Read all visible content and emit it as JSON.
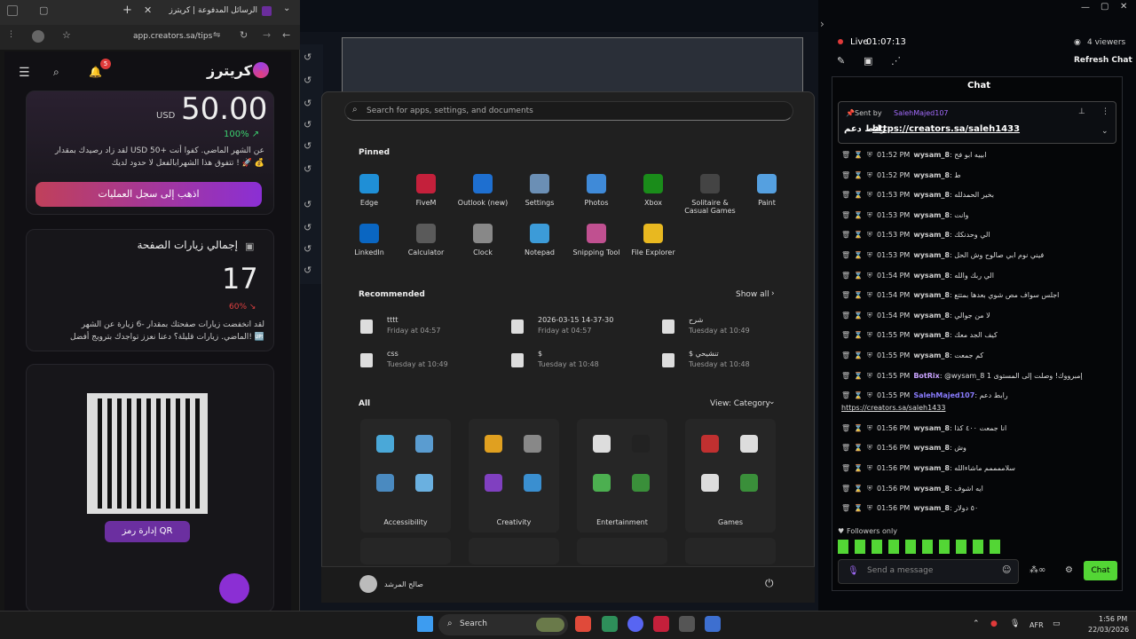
{
  "browser": {
    "tab_title": "الرسائل المدفوعة | كريترز",
    "url": "app.creators.sa/tips",
    "site": {
      "logo": "كريترز",
      "notif_count": "5",
      "amount": "50.00",
      "currency": "USD",
      "change_pct": "100% ↗",
      "balance_text_1": "لقد زاد رصيدك بمقدار USD 50+ عن الشهر الماضي. كفوا أنت",
      "balance_text_2": "تتفوق هذا الشهرابالفعل لا حدود لديك ! 🚀 💰",
      "transactions_button": "اذهب إلى سجل العمليات",
      "visits_title": "إجمالي زيارات الصفحة",
      "visits_value": "17",
      "visits_change": "60% ↘",
      "visits_text_1": "لقد انخفضت زيارات صفحتك بمقدار -6 زيارة عن الشهر",
      "visits_text_2": "الماضي. زيارات قليلة؟ دعنا نعزز تواجدك بترويج أفضل! 🆙",
      "qr_button": "إدارة رمز QR"
    }
  },
  "start_menu": {
    "search_placeholder": "Search for apps, settings, and documents",
    "pinned_title": "Pinned",
    "pinned": [
      {
        "label": "Edge",
        "icon": "edge-icon",
        "color": "#1f8fd6"
      },
      {
        "label": "FiveM",
        "icon": "fivem-icon",
        "color": "#c4203b"
      },
      {
        "label": "Outlook (new)",
        "icon": "outlook-icon",
        "color": "#1e6fd0"
      },
      {
        "label": "Settings",
        "icon": "settings-icon",
        "color": "#6b8fb5"
      },
      {
        "label": "Photos",
        "icon": "photos-icon",
        "color": "#3f8ad8"
      },
      {
        "label": "Xbox",
        "icon": "xbox-icon",
        "color": "#1a8c1a"
      },
      {
        "label": "Solitaire & Casual Games",
        "icon": "solitaire-icon",
        "color": "#444"
      },
      {
        "label": "Paint",
        "icon": "paint-icon",
        "color": "#55a0e0"
      },
      {
        "label": "LinkedIn",
        "icon": "linkedin-icon",
        "color": "#0a66c2"
      },
      {
        "label": "Calculator",
        "icon": "calculator-icon",
        "color": "#5a5a5a"
      },
      {
        "label": "Clock",
        "icon": "clock-icon",
        "color": "#888"
      },
      {
        "label": "Notepad",
        "icon": "notepad-icon",
        "color": "#3c9bd8"
      },
      {
        "label": "Snipping Tool",
        "icon": "snipping-tool-icon",
        "color": "#c05090"
      },
      {
        "label": "File Explorer",
        "icon": "file-explorer-icon",
        "color": "#e8b820"
      }
    ],
    "recommended_title": "Recommended",
    "show_all": "Show all",
    "recommended": [
      {
        "title": "tttt",
        "sub": "Friday at 04:57"
      },
      {
        "title": "2026-03-15 14-37-30",
        "sub": "Friday at 04:57"
      },
      {
        "title": "شرح",
        "sub": "Tuesday at 10:49"
      },
      {
        "title": "css",
        "sub": "Tuesday at 10:49"
      },
      {
        "title": "$",
        "sub": "Tuesday at 10:48"
      },
      {
        "title": "$ تنشيحي",
        "sub": "Tuesday at 10:48"
      }
    ],
    "all_title": "All",
    "view_label": "View: Category",
    "categories": [
      "Accessibility",
      "Creativity",
      "Entertainment",
      "Games"
    ],
    "user_name": "صالح المرشد"
  },
  "chat": {
    "live_label": "Live",
    "live_time": "01:07:13",
    "viewers": "4 viewers",
    "refresh": "Refresh Chat",
    "title": "Chat",
    "pinned_sent_by": "Sent by",
    "pinned_user": "SalehMajed107",
    "pinned_msg": "رابط دعم",
    "pinned_link": "https://creators.sa/saleh1433",
    "messages": [
      {
        "time": "01:52 PM",
        "user": "wysam_8",
        "text": "ابييه ابو فح"
      },
      {
        "time": "01:52 PM",
        "user": "wysam_8",
        "text": "ط"
      },
      {
        "time": "01:53 PM",
        "user": "wysam_8",
        "text": "بخير الحمدلله"
      },
      {
        "time": "01:53 PM",
        "user": "wysam_8",
        "text": "وانت"
      },
      {
        "time": "01:53 PM",
        "user": "wysam_8",
        "text": "الي وحدنكك"
      },
      {
        "time": "01:53 PM",
        "user": "wysam_8",
        "text": "فيني نوم ابي صالوح وش الحل"
      },
      {
        "time": "01:54 PM",
        "user": "wysam_8",
        "text": "الي ربك والله"
      },
      {
        "time": "01:54 PM",
        "user": "wysam_8",
        "text": "اجلس سواف مص شوي بعدها بمتتع"
      },
      {
        "time": "01:54 PM",
        "user": "wysam_8",
        "text": "لا من جوالي"
      },
      {
        "time": "01:55 PM",
        "user": "wysam_8",
        "text": "كيف الجد معك"
      },
      {
        "time": "01:55 PM",
        "user": "wysam_8",
        "text": "كم جمعت"
      },
      {
        "time": "01:55 PM",
        "user": "BotRix",
        "text": "@wysam_8 1 إمبرووك! وصلت إلى المستوى"
      },
      {
        "time": "01:55 PM",
        "user": "SalehMajed107",
        "text": "رابط دعم"
      },
      {
        "time": "01:56 PM",
        "user": "wysam_8",
        "text": "انا جمعت ٤٠٠ كذا"
      },
      {
        "time": "01:56 PM",
        "user": "wysam_8",
        "text": "وش"
      },
      {
        "time": "01:56 PM",
        "user": "wysam_8",
        "text": "سلاممممم ماشاءالله"
      },
      {
        "time": "01:56 PM",
        "user": "wysam_8",
        "text": "ايه اشوف"
      },
      {
        "time": "01:56 PM",
        "user": "wysam_8",
        "text": "٥٠ دولار"
      }
    ],
    "followers_only": "Followers only",
    "input_placeholder": "Send a message",
    "send_button": "Chat"
  },
  "taskbar": {
    "search": "Search",
    "lang": "AFR",
    "time": "1:56 PM",
    "date": "22/03/2026"
  },
  "colors": {
    "accent_purple": "#8b2fd4",
    "chat_green": "#53d635",
    "start_bg": "#202020"
  }
}
